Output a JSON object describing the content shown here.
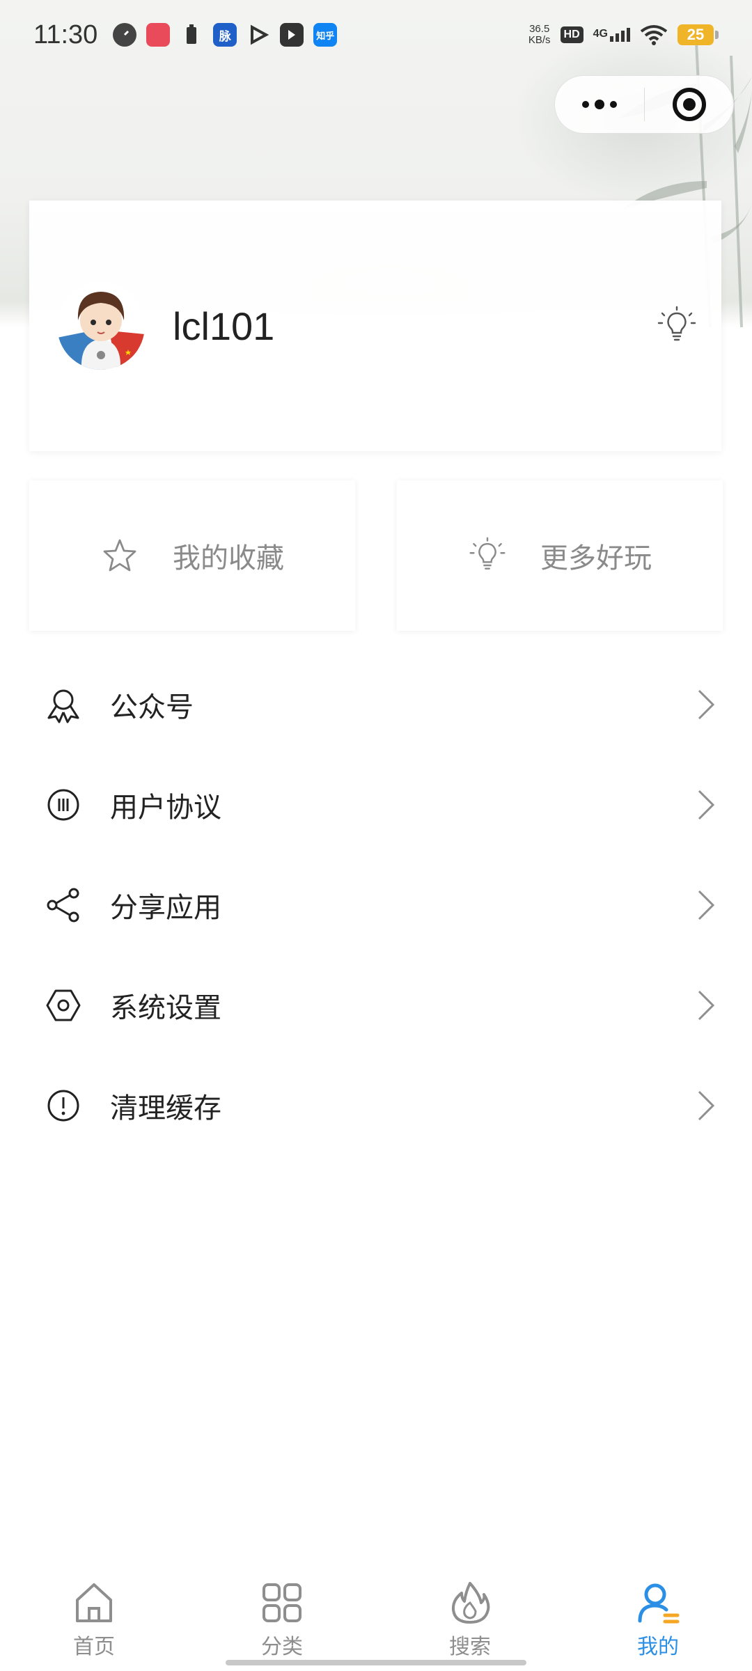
{
  "status_bar": {
    "time": "11:30",
    "net_speed_value": "36.5",
    "net_speed_unit": "KB/s",
    "hd": "HD",
    "network": "4G",
    "battery": "25",
    "app_icons": [
      "speed-icon",
      "jd-icon",
      "battery-saver-icon",
      "mai-icon",
      "play-icon",
      "pen-icon",
      "zhihu-icon"
    ],
    "mai_text": "脉",
    "zhihu_text": "知乎"
  },
  "capsule": {
    "more_icon": "more-dots-icon",
    "close_icon": "target-close-icon"
  },
  "profile": {
    "username": "lcl101",
    "avatar_icon": "user-avatar",
    "action_icon": "lightbulb-icon"
  },
  "quick_actions": [
    {
      "label": "我的收藏",
      "icon": "star-icon"
    },
    {
      "label": "更多好玩",
      "icon": "lightbulb-icon"
    }
  ],
  "menu": [
    {
      "label": "公众号",
      "icon": "award-icon"
    },
    {
      "label": "用户协议",
      "icon": "pause-circle-icon"
    },
    {
      "label": "分享应用",
      "icon": "share-icon"
    },
    {
      "label": "系统设置",
      "icon": "settings-hexagon-icon"
    },
    {
      "label": "清理缓存",
      "icon": "alert-circle-icon"
    }
  ],
  "tabbar": [
    {
      "label": "首页",
      "icon": "home-icon",
      "active": false
    },
    {
      "label": "分类",
      "icon": "grid-icon",
      "active": false
    },
    {
      "label": "搜索",
      "icon": "flame-icon",
      "active": false
    },
    {
      "label": "我的",
      "icon": "user-icon",
      "active": true
    }
  ],
  "colors": {
    "accent": "#2b8fe6",
    "accent_secondary": "#f5a623",
    "text": "#222222",
    "muted": "#8a8a8a",
    "battery": "#f0b429"
  }
}
